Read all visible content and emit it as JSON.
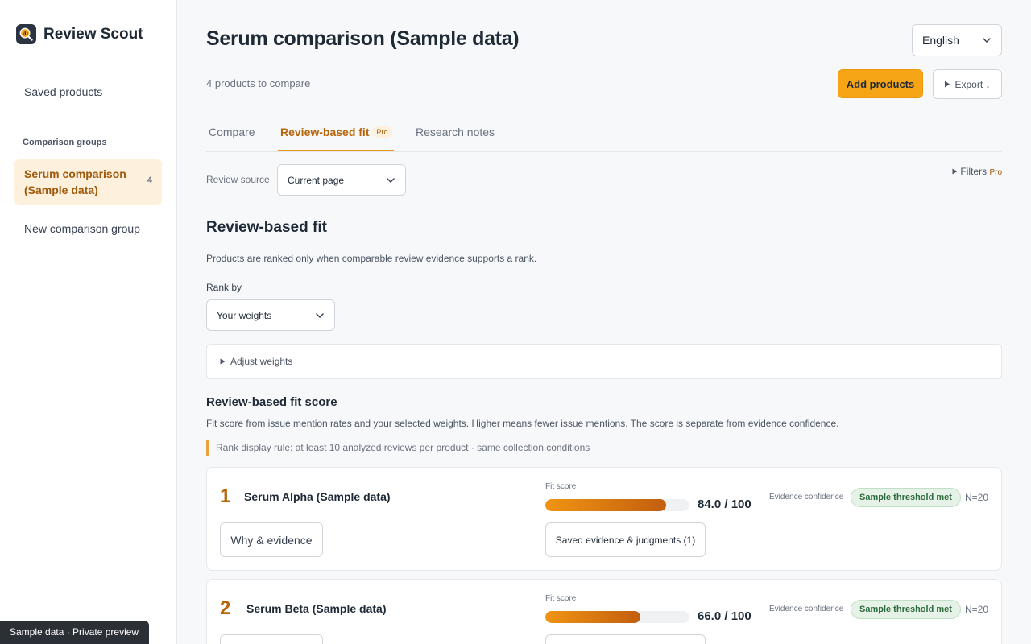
{
  "app": {
    "name": "Review Scout",
    "footer_badge": "Sample data · Private preview"
  },
  "sidebar": {
    "saved_products": "Saved products",
    "section_label": "Comparison groups",
    "groups": [
      {
        "label": "Serum comparison (Sample data)",
        "count": "4",
        "active": true
      }
    ],
    "new_group": "New comparison group"
  },
  "header": {
    "title": "Serum comparison (Sample data)",
    "subtitle": "4 products to compare",
    "language": "English",
    "add_products": "Add products",
    "export": "Export ↓"
  },
  "tabs": [
    {
      "label": "Compare",
      "active": false
    },
    {
      "label": "Review-based fit",
      "active": true,
      "badge": "Pro"
    },
    {
      "label": "Research notes",
      "active": false
    }
  ],
  "review_source": {
    "label": "Review source",
    "value": "Current page"
  },
  "filters": {
    "label": "Filters",
    "badge": "Pro"
  },
  "fit": {
    "title": "Review-based fit",
    "description": "Products are ranked only when comparable review evidence supports a rank.",
    "rank_by_label": "Rank by",
    "rank_by_value": "Your weights",
    "adjust_weights": "Adjust weights",
    "score_title": "Review-based fit score",
    "score_description": "Fit score from issue mention rates and your selected weights. Higher means fewer issue mentions. The score is separate from evidence confidence.",
    "rule_note": "Rank display rule: at least 10 analyzed reviews per product · same collection conditions"
  },
  "products": [
    {
      "rank": "1",
      "name": "Serum Alpha (Sample data)",
      "fit_label": "Fit score",
      "score": 84.0,
      "score_text": "84.0 / 100",
      "confidence_label": "Evidence confidence",
      "confidence_badge": "Sample threshold met",
      "n": "N=20",
      "why_button": "Why & evidence",
      "saved_button": "Saved evidence & judgments (1)"
    },
    {
      "rank": "2",
      "name": "Serum Beta (Sample data)",
      "fit_label": "Fit score",
      "score": 66.0,
      "score_text": "66.0 / 100",
      "confidence_label": "Evidence confidence",
      "confidence_badge": "Sample threshold met",
      "n": "N=20",
      "why_button": "",
      "saved_button": ""
    }
  ],
  "colors": {
    "accent": "#f5a516",
    "accent_text": "#b8650a",
    "success_bg": "#e6f2e8",
    "success_text": "#2e6b3c"
  }
}
